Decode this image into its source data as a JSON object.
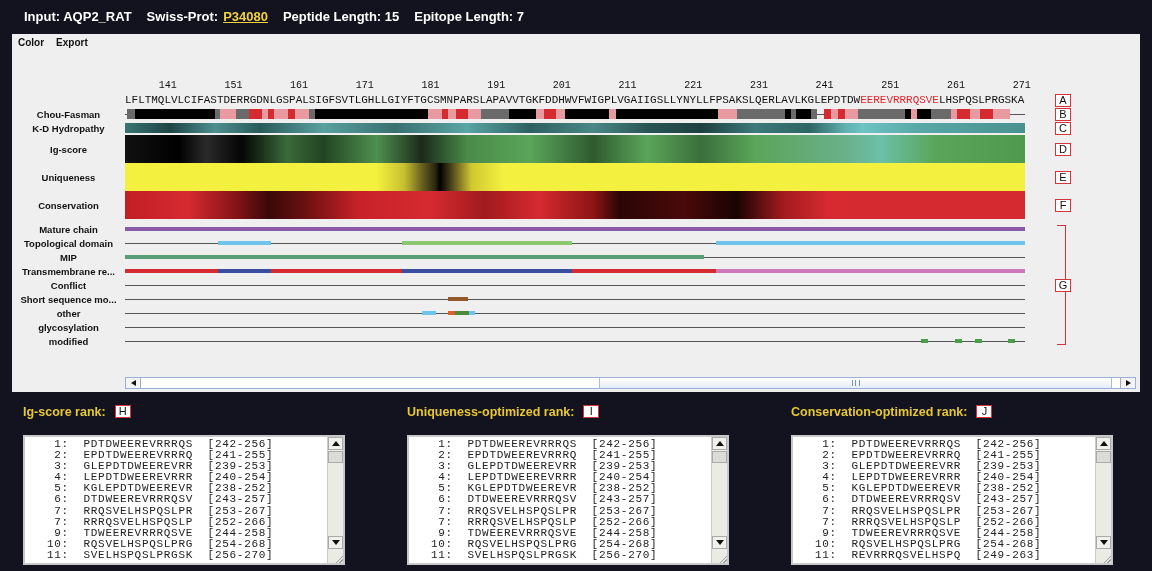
{
  "header": {
    "input": "Input: AQP2_RAT",
    "swissprot_label": "Swiss-Prot:",
    "swissprot_id": "P34080",
    "peptide_length": "Peptide Length: 15",
    "epitope_length": "Epitope Length: 7"
  },
  "menu": [
    "Color",
    "Export"
  ],
  "ruler": [
    "141",
    "151",
    "161",
    "171",
    "181",
    "191",
    "201",
    "211",
    "221",
    "231",
    "241",
    "251",
    "261",
    "271"
  ],
  "sequence_marker": "A",
  "sequence": [
    {
      "text": "LFLTMQLVLCIFASTDERRGDNLGSPALSIGFSVTLGHLLGIYFTGCSMNPARSLAPAVVTGKFDDHWVFWIGPLVGAIIGSLLYNYLLFPSAKSLQERLAVLKGLEPDTDW",
      "highlighted": false
    },
    {
      "text": "EEREVRRRQSVE",
      "highlighted": true
    },
    {
      "text": "LHSPQSLPRGSKA",
      "highlighted": false
    }
  ],
  "tracks": [
    {
      "label": "Chou-Fasman",
      "marker": "B",
      "kind": "chou-fasman"
    },
    {
      "label": "K-D Hydropathy",
      "marker": "C",
      "kind": "hydropathy"
    },
    {
      "label": "Ig-score",
      "marker": "D",
      "kind": "ig-score"
    },
    {
      "label": "Uniqueness",
      "marker": "E",
      "kind": "uniqueness"
    },
    {
      "label": "Conservation",
      "marker": "F",
      "kind": "conservation"
    }
  ],
  "features": {
    "marker": "G",
    "rows": [
      {
        "label": "Mature chain"
      },
      {
        "label": "Topological domain"
      },
      {
        "label": "MIP"
      },
      {
        "label": "Transmembrane re..."
      },
      {
        "label": "Conflict"
      },
      {
        "label": "Short sequence mo..."
      },
      {
        "label": "other"
      },
      {
        "label": "glycosylation"
      },
      {
        "label": "modified"
      }
    ]
  },
  "ranks": [
    {
      "title": "Ig-score rank:",
      "marker": "H",
      "rows": [
        " 1:  PDTDWEEREVRRRQS  [242-256]",
        " 2:  EPDTDWEEREVRRRQ  [241-255]",
        " 3:  GLEPDTDWEEREVRR  [239-253]",
        " 4:  LEPDTDWEEREVRRR  [240-254]",
        " 5:  KGLEPDTDWEEREVR  [238-252]",
        " 6:  DTDWEEREVRRRQSV  [243-257]",
        " 7:  RRQSVELHSPQSLPR  [253-267]",
        " 7:  RRRQSVELHSPQSLP  [252-266]",
        " 9:  TDWEEREVRRRQSVE  [244-258]",
        "10:  RQSVELHSPQSLPRG  [254-268]",
        "11:  SVELHSPQSLPRGSK  [256-270]"
      ]
    },
    {
      "title": "Uniqueness-optimized rank:",
      "marker": "I",
      "rows": [
        " 1:  PDTDWEEREVRRRQS  [242-256]",
        " 2:  EPDTDWEEREVRRRQ  [241-255]",
        " 3:  GLEPDTDWEEREVRR  [239-253]",
        " 4:  LEPDTDWEEREVRRR  [240-254]",
        " 5:  KGLEPDTDWEEREVR  [238-252]",
        " 6:  DTDWEEREVRRRQSV  [243-257]",
        " 7:  RRQSVELHSPQSLPR  [253-267]",
        " 7:  RRRQSVELHSPQSLP  [252-266]",
        " 9:  TDWEEREVRRRQSVE  [244-258]",
        "10:  RQSVELHSPQSLPRG  [254-268]",
        "11:  SVELHSPQSLPRGSK  [256-270]"
      ]
    },
    {
      "title": "Conservation-optimized rank:",
      "marker": "J",
      "rows": [
        " 1:  PDTDWEEREVRRRQS  [242-256]",
        " 2:  EPDTDWEEREVRRRQ  [241-255]",
        " 3:  GLEPDTDWEEREVRR  [239-253]",
        " 4:  LEPDTDWEEREVRRR  [240-254]",
        " 5:  KGLEPDTDWEEREVR  [238-252]",
        " 6:  DTDWEEREVRRRQSV  [243-257]",
        " 7:  RRQSVELHSPQSLPR  [253-267]",
        " 7:  RRRQSVELHSPQSLP  [252-266]",
        " 9:  TDWEEREVRRRQSVE  [244-258]",
        "10:  RQSVELHSPQSLPRG  [254-268]",
        "11:  REVRRRQSVELHSPQ  [249-263]"
      ]
    }
  ]
}
